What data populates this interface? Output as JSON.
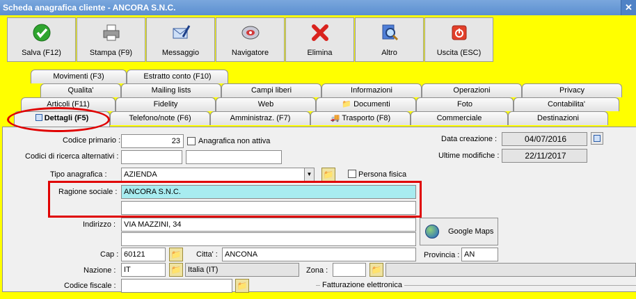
{
  "window": {
    "title": "Scheda anagrafica cliente - ANCORA S.N.C.",
    "close": "✕"
  },
  "toolbar": [
    {
      "label": "Salva (F12)",
      "icon": "check-icon"
    },
    {
      "label": "Stampa (F9)",
      "icon": "printer-icon"
    },
    {
      "label": "Messaggio",
      "icon": "envelope-pen-icon"
    },
    {
      "label": "Navigatore",
      "icon": "compass-icon"
    },
    {
      "label": "Elimina",
      "icon": "delete-x-icon"
    },
    {
      "label": "Altro",
      "icon": "magnifier-icon"
    },
    {
      "label": "Uscita (ESC)",
      "icon": "power-icon"
    }
  ],
  "tabs": {
    "row1": [
      "Movimenti (F3)",
      "Estratto conto (F10)"
    ],
    "row2": [
      "Qualita'",
      "Mailing lists",
      "Campi liberi",
      "Informazioni",
      "Operazioni",
      "Privacy"
    ],
    "row3": [
      "Articoli (F11)",
      "Fidelity",
      "Web",
      "Documenti",
      "Foto",
      "Contabilita'"
    ],
    "row4": [
      "Dettagli (F5)",
      "Telefono/note (F6)",
      "Amministraz. (F7)",
      "Trasporto (F8)",
      "Commerciale",
      "Destinazioni"
    ]
  },
  "form": {
    "codice_primario_label": "Codice primario :",
    "codice_primario": "23",
    "anagrafica_non_attiva": "Anagrafica non attiva",
    "codici_ricerca_label": "Codici di ricerca alternativi :",
    "tipo_anagrafica_label": "Tipo anagrafica :",
    "tipo_anagrafica": "AZIENDA",
    "persona_fisica": "Persona fisica",
    "ragione_sociale_label": "Ragione sociale :",
    "ragione_sociale": "ANCORA S.N.C.",
    "indirizzo_label": "Indirizzo :",
    "indirizzo": "VIA MAZZINI, 34",
    "cap_label": "Cap :",
    "cap": "60121",
    "citta_label": "Citta' :",
    "citta": "ANCONA",
    "provincia_label": "Provincia :",
    "provincia": "AN",
    "nazione_label": "Nazione :",
    "nazione": "IT",
    "nazione_desc": "Italia (IT)",
    "zona_label": "Zona :",
    "codice_fiscale_label": "Codice fiscale :",
    "data_creazione_label": "Data creazione :",
    "data_creazione": "04/07/2016",
    "ultime_modifiche_label": "Ultime modifiche :",
    "ultime_modifiche": "22/11/2017",
    "google_maps": "Google Maps",
    "fatturazione_elettronica": "Fatturazione elettronica"
  }
}
